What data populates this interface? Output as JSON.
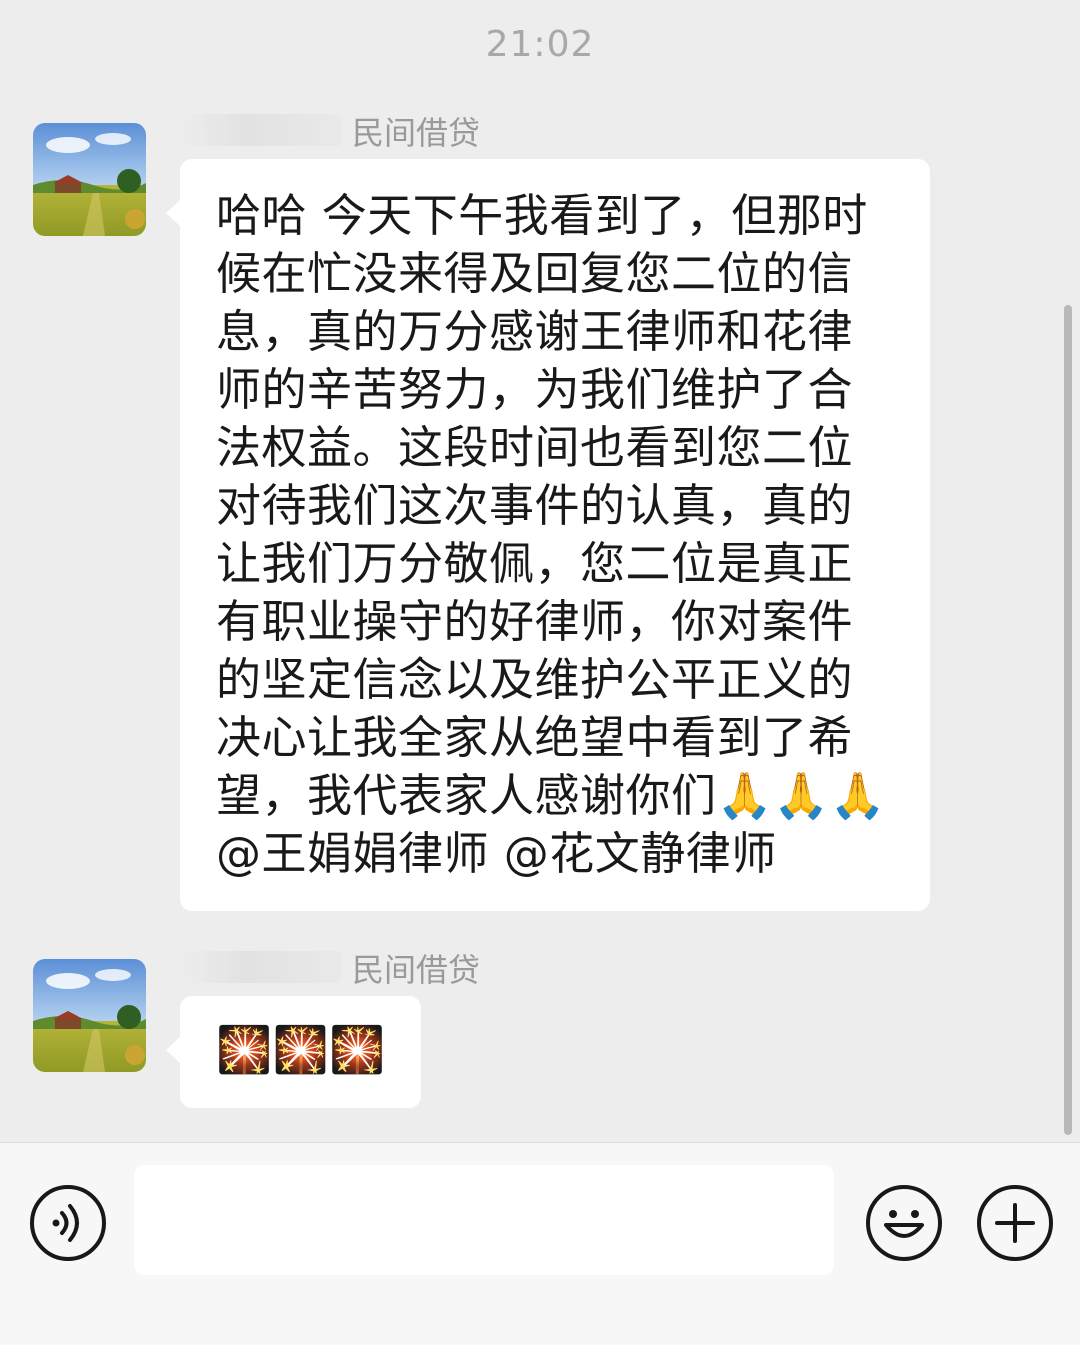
{
  "status": {
    "timestamp": "21:02"
  },
  "messages": [
    {
      "sender": "民间借贷",
      "text": "哈哈 今天下午我看到了，但那时候在忙没来得及回复您二位的信息，真的万分感谢王律师和花律师的辛苦努力，为我们维护了合法权益。这段时间也看到您二位对待我们这次事件的认真，真的让我们万分敬佩，您二位是真正有职业操守的好律师，你对案件的坚定信念以及维护公平正义的决心让我全家从绝望中看到了希望，我代表家人感谢你们🙏🙏🙏@王娟娟律师 @花文静律师"
    },
    {
      "sender": "民间借贷",
      "text": "🎇🎇🎇"
    }
  ],
  "input_bar": {
    "voice_icon": "voice-icon",
    "emoji_icon": "emoji-icon",
    "plus_icon": "plus-icon",
    "input_value": ""
  }
}
